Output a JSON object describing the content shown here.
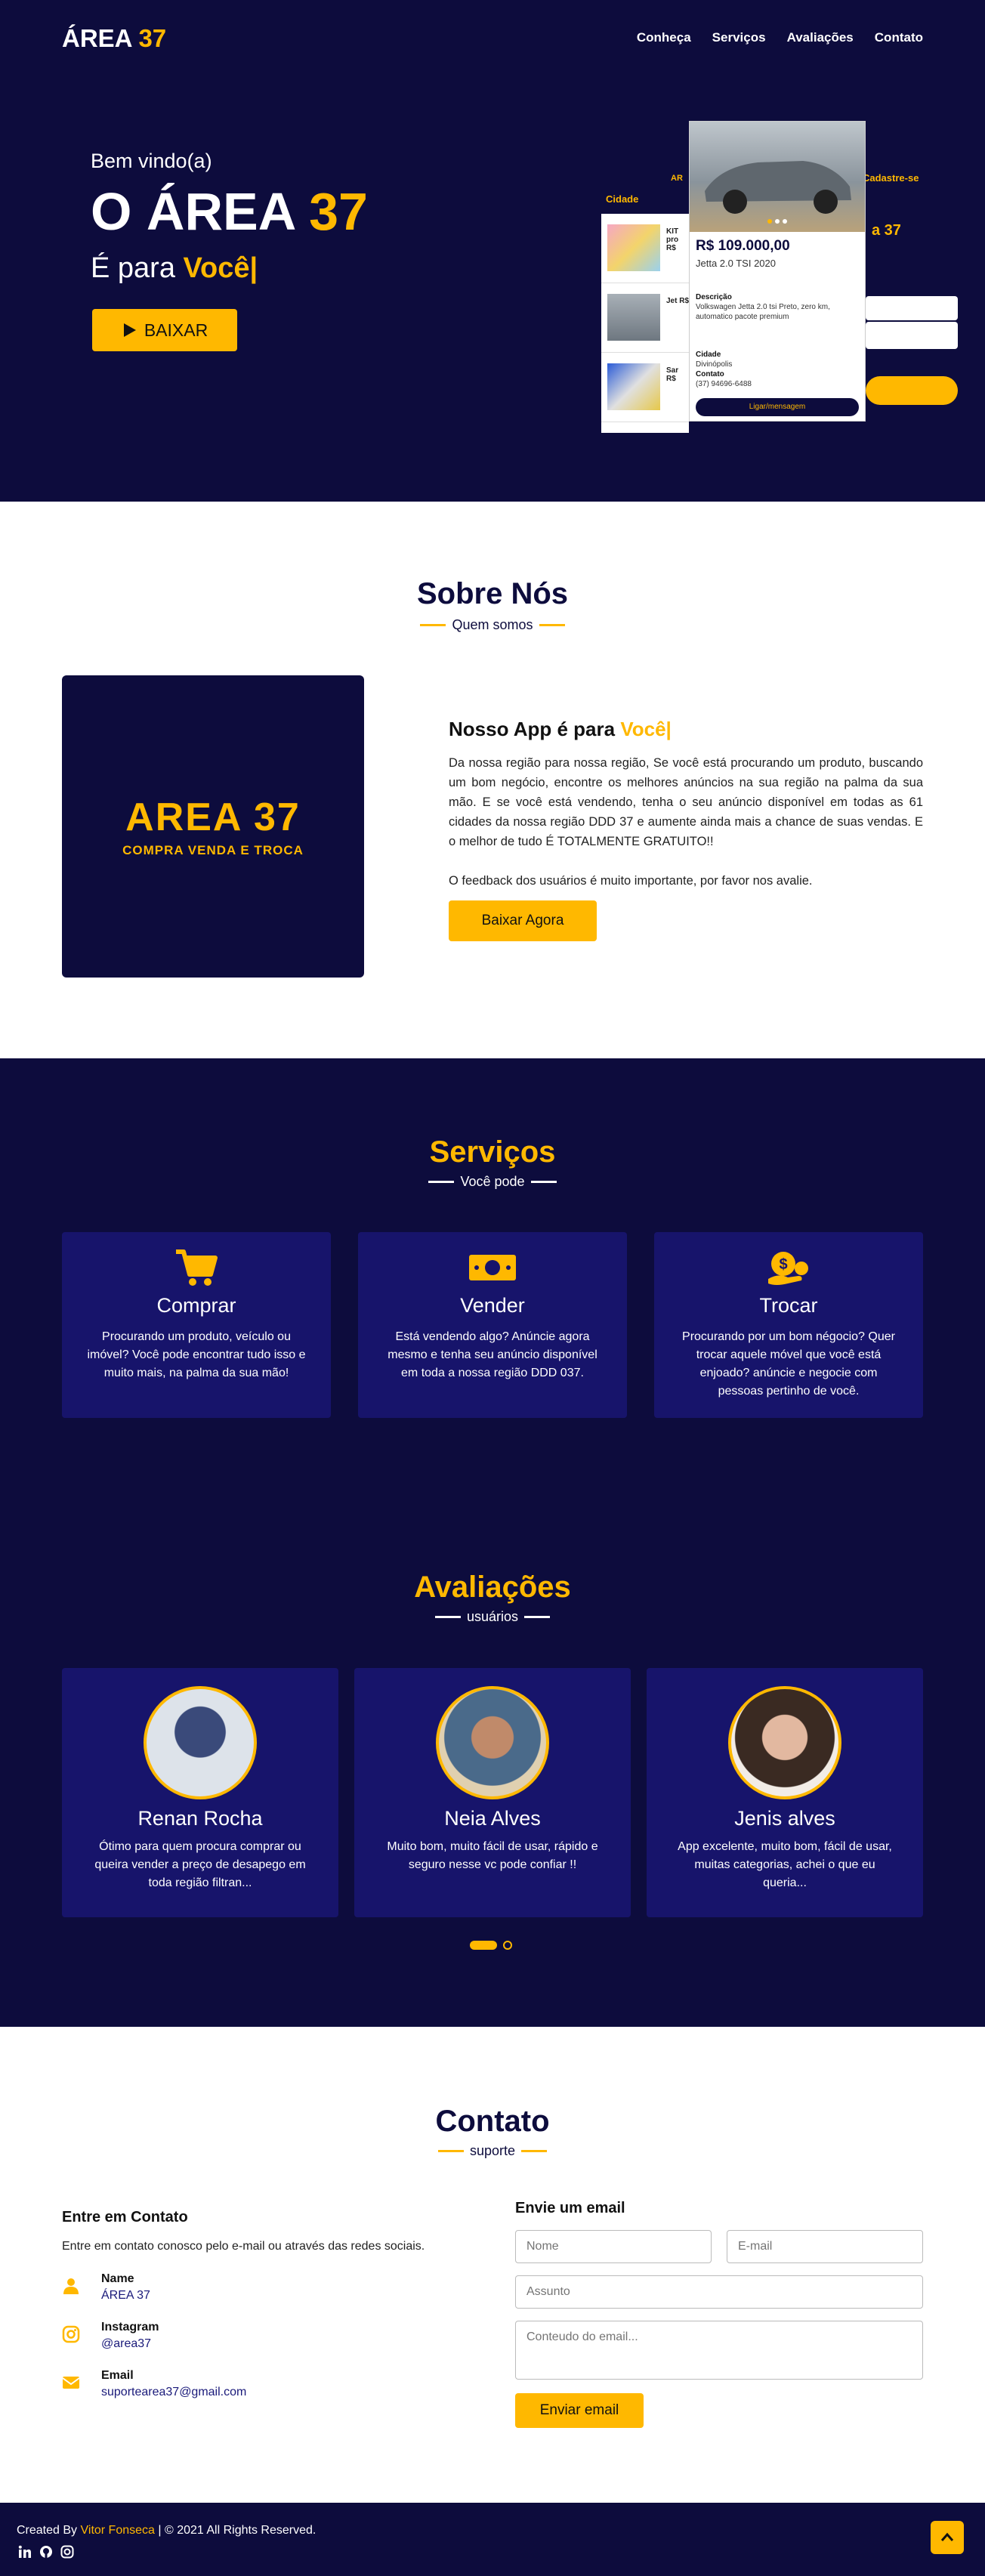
{
  "colors": {
    "navy": "#0d0c3d",
    "card": "#17146b",
    "accent": "#ffb800"
  },
  "header": {
    "logo_main": "ÁREA",
    "logo_num": "37",
    "nav": [
      "Conheça",
      "Serviços",
      "Avaliações",
      "Contato"
    ]
  },
  "hero": {
    "welcome": "Bem vindo(a)",
    "title_main": "O ÁREA",
    "title_num": "37",
    "sub_prefix": "É para",
    "sub_accent": "Você|",
    "button": "BAIXAR"
  },
  "mockup": {
    "back_labels": [
      "Cidade",
      "AR",
      "Cadastre-se"
    ],
    "list_items": [
      "KIT pro R$",
      "Jet R$",
      "Sar R$"
    ],
    "price": "R$ 109.000,00",
    "model": "Jetta 2.0 TSI 2020",
    "desc_label": "Descrição",
    "desc": "Volkswagen Jetta 2.0 tsi Preto, zero km, automatico pacote premium",
    "city_label": "Cidade",
    "city": "Divinópolis",
    "contact_label": "Contato",
    "contact": "(37) 94696-6488",
    "button": "Ligar/mensagem"
  },
  "about": {
    "title": "Sobre Nós",
    "subtitle": "Quem somos",
    "logo_t1": "AREA 37",
    "logo_t2": "COMPRA VENDA E TROCA",
    "heading_prefix": "Nosso App é para",
    "heading_accent": "Você|",
    "para1": "Da nossa região para nossa região, Se você está procurando um produto, buscando um bom negócio, encontre os melhores anúncios na sua região na palma da sua mão. E se você está vendendo, tenha o seu anúncio disponível em todas as 61 cidades da nossa região DDD 37 e aumente ainda mais a chance de suas vendas. E o melhor de tudo É TOTALMENTE GRATUITO!!",
    "para2": "O feedback dos usuários é muito importante, por favor nos avalie.",
    "button": "Baixar Agora"
  },
  "services": {
    "title": "Serviços",
    "subtitle": "Você pode",
    "items": [
      {
        "icon": "cart-icon",
        "title": "Comprar",
        "text": "Procurando um produto, veículo ou imóvel? Você pode encontrar tudo isso e muito mais, na palma da sua mão!"
      },
      {
        "icon": "money-icon",
        "title": "Vender",
        "text": "Está vendendo algo? Anúncie agora mesmo e tenha seu anúncio disponível em toda a nossa região DDD 037."
      },
      {
        "icon": "coins-icon",
        "title": "Trocar",
        "text": "Procurando por um bom négocio? Quer trocar aquele móvel que você está enjoado? anúncie e negocie com pessoas pertinho de você."
      }
    ]
  },
  "reviews": {
    "title": "Avaliações",
    "subtitle": "usuários",
    "items": [
      {
        "name": "Renan Rocha",
        "text": "Ótimo para quem procura comprar ou queira vender a preço de desapego em toda região filtran..."
      },
      {
        "name": "Neia Alves",
        "text": "Muito bom, muito fácil de usar, rápido e seguro nesse vc pode confiar !!"
      },
      {
        "name": "Jenis alves",
        "text": "App excelente, muito bom, fácil de usar, muitas categorias, achei o que eu queria..."
      }
    ]
  },
  "contact": {
    "title": "Contato",
    "subtitle": "suporte",
    "left_title": "Entre em Contato",
    "left_text": "Entre em contato conosco pelo e-mail ou através das redes sociais.",
    "items": [
      {
        "label": "Name",
        "value": "ÁREA 37"
      },
      {
        "label": "Instagram",
        "value": "@area37"
      },
      {
        "label": "Email",
        "value": "suportearea37@gmail.com"
      }
    ],
    "form_title": "Envie um email",
    "ph_name": "Nome",
    "ph_email": "E-mail",
    "ph_subject": "Assunto",
    "ph_message": "Conteudo do email...",
    "send": "Enviar email"
  },
  "footer": {
    "prefix": "Created By",
    "author": "Vitor Fonseca",
    "suffix": "| © 2021 All Rights Reserved."
  }
}
